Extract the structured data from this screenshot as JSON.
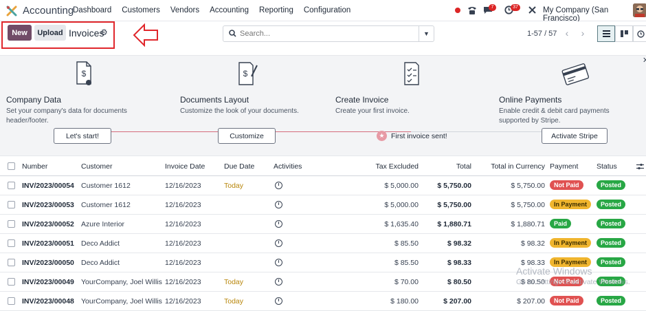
{
  "topnav": {
    "app_name": "Accounting",
    "menu": [
      "Dashboard",
      "Customers",
      "Vendors",
      "Accounting",
      "Reporting",
      "Configuration"
    ],
    "messages_count": "7",
    "activities_count": "37",
    "company": "My Company (San Francisco)"
  },
  "control_panel": {
    "new_label": "New",
    "upload_label": "Upload",
    "title": "Invoices",
    "search_placeholder": "Search...",
    "pager": "1-57 / 57"
  },
  "onboarding": {
    "steps": [
      {
        "title": "Company Data",
        "desc1": "Set your company's data for documents",
        "desc2": "header/footer.",
        "button": "Let's start!"
      },
      {
        "title": "Documents Layout",
        "desc1": "Customize the look of your documents.",
        "desc2": "",
        "button": "Customize"
      },
      {
        "title": "Create Invoice",
        "desc1": "Create your first invoice.",
        "desc2": "",
        "done": "First invoice sent!"
      },
      {
        "title": "Online Payments",
        "desc1": "Enable credit & debit card payments",
        "desc2": "supported by Stripe.",
        "button": "Activate Stripe"
      }
    ]
  },
  "table": {
    "headers": {
      "number": "Number",
      "customer": "Customer",
      "invoice_date": "Invoice Date",
      "due_date": "Due Date",
      "activities": "Activities",
      "tax_excluded": "Tax Excluded",
      "total": "Total",
      "total_currency": "Total in Currency",
      "payment": "Payment",
      "status": "Status"
    },
    "rows": [
      {
        "number": "INV/2023/00054",
        "customer": "Customer 1612",
        "invoice_date": "12/16/2023",
        "due_date": "Today",
        "tax_excluded": "$ 5,000.00",
        "total": "$ 5,750.00",
        "total_currency": "$ 5,750.00",
        "payment": "Not Paid",
        "payment_color": "#e05252",
        "status": "Posted"
      },
      {
        "number": "INV/2023/00053",
        "customer": "Customer 1612",
        "invoice_date": "12/16/2023",
        "due_date": "",
        "tax_excluded": "$ 5,000.00",
        "total": "$ 5,750.00",
        "total_currency": "$ 5,750.00",
        "payment": "In Payment",
        "payment_color": "#f0b52e",
        "status": "Posted"
      },
      {
        "number": "INV/2023/00052",
        "customer": "Azure Interior",
        "invoice_date": "12/16/2023",
        "due_date": "",
        "tax_excluded": "$ 1,635.40",
        "total": "$ 1,880.71",
        "total_currency": "$ 1,880.71",
        "payment": "Paid",
        "payment_color": "#28a745",
        "status": "Posted"
      },
      {
        "number": "INV/2023/00051",
        "customer": "Deco Addict",
        "invoice_date": "12/16/2023",
        "due_date": "",
        "tax_excluded": "$ 85.50",
        "total": "$ 98.32",
        "total_currency": "$ 98.32",
        "payment": "In Payment",
        "payment_color": "#f0b52e",
        "status": "Posted"
      },
      {
        "number": "INV/2023/00050",
        "customer": "Deco Addict",
        "invoice_date": "12/16/2023",
        "due_date": "",
        "tax_excluded": "$ 85.50",
        "total": "$ 98.33",
        "total_currency": "$ 98.33",
        "payment": "In Payment",
        "payment_color": "#f0b52e",
        "status": "Posted"
      },
      {
        "number": "INV/2023/00049",
        "customer": "YourCompany, Joel Willis",
        "invoice_date": "12/16/2023",
        "due_date": "Today",
        "tax_excluded": "$ 70.00",
        "total": "$ 80.50",
        "total_currency": "$ 80.50",
        "payment": "Not Paid",
        "payment_color": "#e05252",
        "status": "Posted"
      },
      {
        "number": "INV/2023/00048",
        "customer": "YourCompany, Joel Willis",
        "invoice_date": "12/16/2023",
        "due_date": "Today",
        "tax_excluded": "$ 180.00",
        "total": "$ 207.00",
        "total_currency": "$ 207.00",
        "payment": "Not Paid",
        "payment_color": "#e05252",
        "status": "Posted"
      }
    ]
  },
  "watermark": {
    "line1": "Activate Windows",
    "line2": "Go to Settings to activate Windows."
  },
  "colors": {
    "brand": "#714b67",
    "annotation": "#e0262b"
  }
}
